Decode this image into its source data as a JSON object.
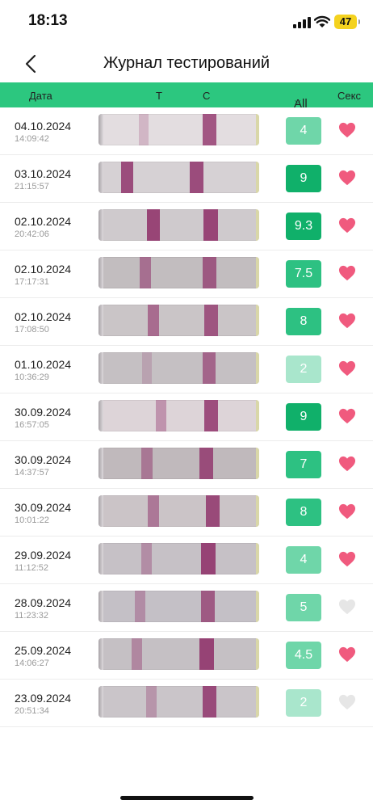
{
  "status_bar": {
    "time": "18:13",
    "battery": "47"
  },
  "nav": {
    "title": "Журнал тестирований"
  },
  "table_header": {
    "date": "Дата",
    "t": "Т",
    "c": "С",
    "all": "All",
    "sex": "Секс"
  },
  "colors": {
    "header_green": "#2cc77f",
    "heart_active": "#f05a7e",
    "heart_inactive": "#e6e6e6"
  },
  "rows": [
    {
      "date": "04.10.2024",
      "time": "14:09:42",
      "score": "4",
      "heart": true,
      "t": 0.08,
      "c": 0.8,
      "t_pos": 0.28,
      "c_pos": 0.69,
      "strip": "#e3dde0"
    },
    {
      "date": "03.10.2024",
      "time": "21:15:57",
      "score": "9",
      "heart": true,
      "t": 0.85,
      "c": 0.85,
      "t_pos": 0.18,
      "c_pos": 0.61,
      "strip": "#d6d1d4"
    },
    {
      "date": "02.10.2024",
      "time": "20:42:06",
      "score": "9.3",
      "heart": true,
      "t": 0.9,
      "c": 0.9,
      "t_pos": 0.34,
      "c_pos": 0.7,
      "strip": "#cfcacd"
    },
    {
      "date": "02.10.2024",
      "time": "17:17:31",
      "score": "7.5",
      "heart": true,
      "t": 0.5,
      "c": 0.7,
      "t_pos": 0.29,
      "c_pos": 0.69,
      "strip": "#c2bdbf"
    },
    {
      "date": "02.10.2024",
      "time": "17:08:50",
      "score": "8",
      "heart": true,
      "t": 0.55,
      "c": 0.75,
      "t_pos": 0.34,
      "c_pos": 0.7,
      "strip": "#cac5c7"
    },
    {
      "date": "01.10.2024",
      "time": "10:36:29",
      "score": "2",
      "heart": true,
      "t": 0.06,
      "c": 0.6,
      "t_pos": 0.3,
      "c_pos": 0.69,
      "strip": "#c5c0c3"
    },
    {
      "date": "30.09.2024",
      "time": "16:57:05",
      "score": "9",
      "heart": true,
      "t": 0.3,
      "c": 0.85,
      "t_pos": 0.39,
      "c_pos": 0.7,
      "strip": "#ddd4d8"
    },
    {
      "date": "30.09.2024",
      "time": "14:37:57",
      "score": "7",
      "heart": true,
      "t": 0.4,
      "c": 0.8,
      "t_pos": 0.3,
      "c_pos": 0.67,
      "strip": "#c0b9bc"
    },
    {
      "date": "30.09.2024",
      "time": "10:01:22",
      "score": "8",
      "heart": true,
      "t": 0.45,
      "c": 0.85,
      "t_pos": 0.34,
      "c_pos": 0.71,
      "strip": "#cbc4c7"
    },
    {
      "date": "29.09.2024",
      "time": "11:12:52",
      "score": "4",
      "heart": true,
      "t": 0.25,
      "c": 0.9,
      "t_pos": 0.3,
      "c_pos": 0.68,
      "strip": "#c6c1c6"
    },
    {
      "date": "28.09.2024",
      "time": "11:23:32",
      "score": "5",
      "heart": false,
      "t": 0.25,
      "c": 0.7,
      "t_pos": 0.26,
      "c_pos": 0.68,
      "strip": "#c4c0c6"
    },
    {
      "date": "25.09.2024",
      "time": "14:06:27",
      "score": "4.5",
      "heart": true,
      "t": 0.3,
      "c": 0.9,
      "t_pos": 0.24,
      "c_pos": 0.67,
      "strip": "#c5c0c4"
    },
    {
      "date": "23.09.2024",
      "time": "20:51:34",
      "score": "2",
      "heart": false,
      "t": 0.2,
      "c": 0.85,
      "t_pos": 0.33,
      "c_pos": 0.69,
      "strip": "#cac5c9"
    }
  ]
}
